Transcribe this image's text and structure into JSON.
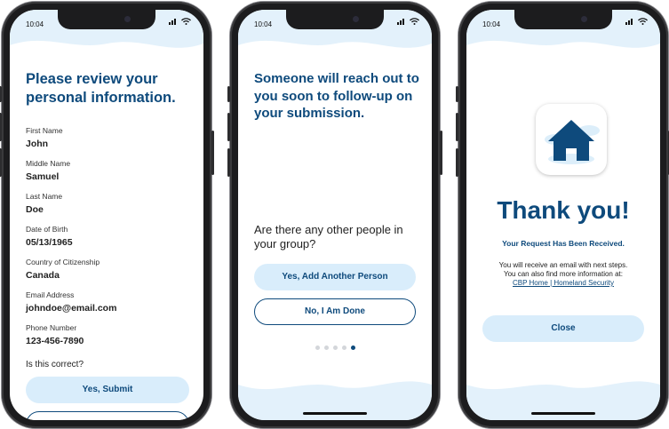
{
  "status": {
    "time": "10:04"
  },
  "screen1": {
    "title": "Please review your personal information.",
    "fields": [
      {
        "label": "First Name",
        "value": "John"
      },
      {
        "label": "Middle Name",
        "value": "Samuel"
      },
      {
        "label": "Last Name",
        "value": "Doe"
      },
      {
        "label": "Date of Birth",
        "value": "05/13/1965"
      },
      {
        "label": "Country of Citizenship",
        "value": "Canada"
      },
      {
        "label": "Email Address",
        "value": "johndoe@email.com"
      },
      {
        "label": "Phone Number",
        "value": "123-456-7890"
      }
    ],
    "question": "Is this correct?",
    "submit_label": "Yes, Submit",
    "secondary_label": ""
  },
  "screen2": {
    "title": "Someone will reach out to you soon to follow-up on your submission.",
    "question": "Are there any other people in your group?",
    "add_label": "Yes, Add Another Person",
    "done_label": "No, I Am Done",
    "page_indicator": {
      "total": 5,
      "active": 5
    }
  },
  "screen3": {
    "icon": "house-icon",
    "heading": "Thank you!",
    "subheading": "Your Request Has Been Received.",
    "info_line1": "You will receive an email with next steps.",
    "info_line2": "You can also find more information at:",
    "link_label": "CBP Home | Homeland Security",
    "close_label": "Close"
  },
  "colors": {
    "brand": "#0e4a7c",
    "button_fill": "#d9edfb",
    "wave": "#e3f1fb"
  }
}
